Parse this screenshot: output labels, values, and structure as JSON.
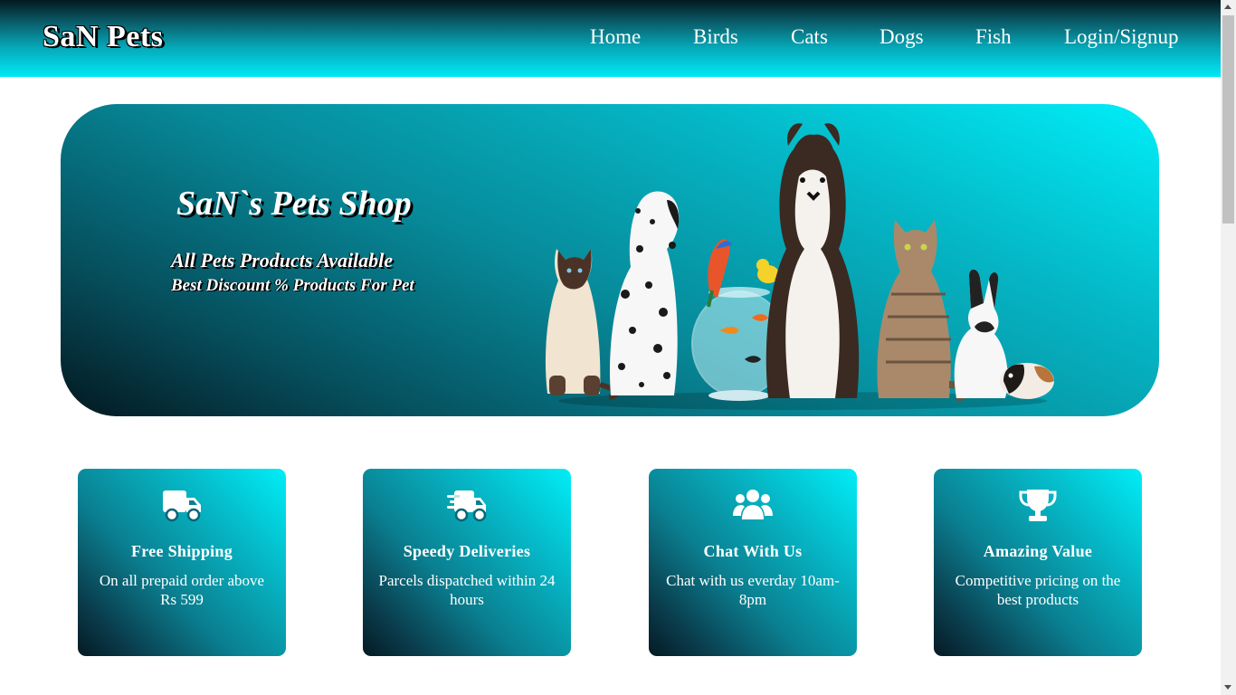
{
  "header": {
    "brand": "SaN Pets",
    "nav": [
      {
        "label": "Home"
      },
      {
        "label": "Birds"
      },
      {
        "label": "Cats"
      },
      {
        "label": "Dogs"
      },
      {
        "label": "Fish"
      },
      {
        "label": "Login/Signup"
      }
    ]
  },
  "hero": {
    "title": "SaN`s Pets Shop",
    "subtitle": "All Pets Products Available",
    "tagline": "Best Discount % Products For Pet",
    "image": "group-of-pets-illustration"
  },
  "features": [
    {
      "icon": "truck-icon",
      "title": "Free Shipping",
      "text": "On all prepaid order above Rs 599"
    },
    {
      "icon": "fast-truck-icon",
      "title": "Speedy Deliveries",
      "text": "Parcels dispatched within 24 hours"
    },
    {
      "icon": "users-icon",
      "title": "Chat With Us",
      "text": "Chat with us everday 10am-8pm"
    },
    {
      "icon": "trophy-icon",
      "title": "Amazing Value",
      "text": "Competitive pricing on the best products"
    }
  ],
  "colors": {
    "accent": "#00e9f7",
    "dark": "#051a24",
    "text": "#ffffff"
  }
}
